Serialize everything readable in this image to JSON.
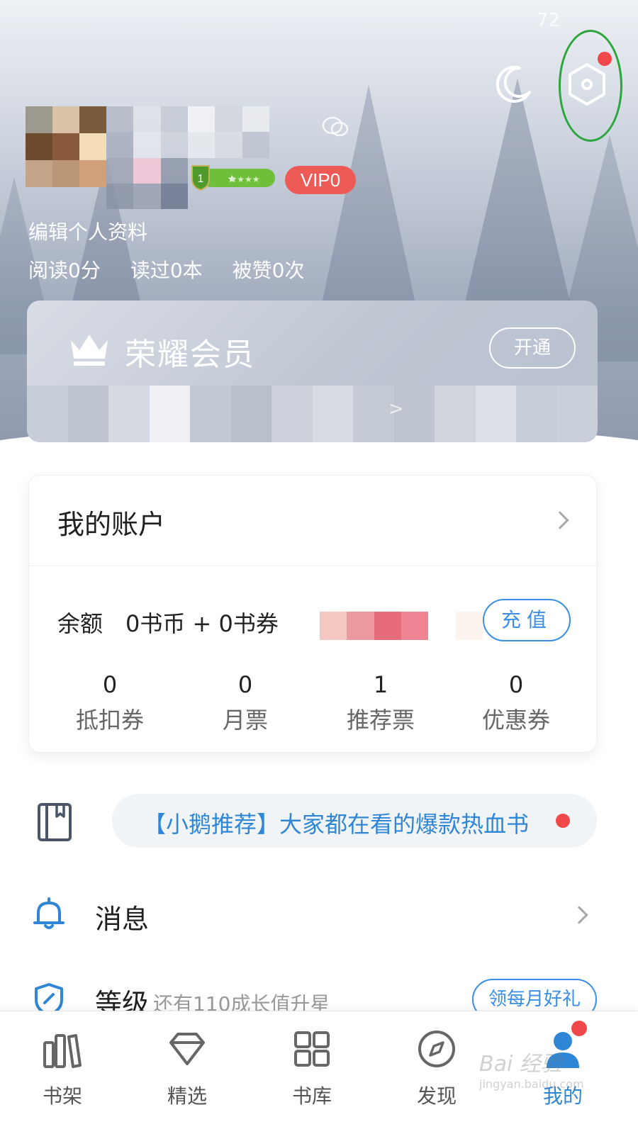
{
  "status_bar": {
    "time": "72"
  },
  "header": {
    "night_mode_icon": "moon-icon",
    "settings_icon": "hexagon-settings-icon",
    "settings_badge": true,
    "highlight_color": "#2aa63c",
    "wechat_icon": "wechat-icon",
    "level_badge_number": "1",
    "vip_label": "VIP0",
    "edit_profile_label": "编辑个人资料",
    "stats": [
      {
        "label": "阅读0分"
      },
      {
        "label": "读过0本"
      },
      {
        "label": "被赞0次"
      }
    ]
  },
  "vip_card": {
    "icon": "crown-icon",
    "title": "荣耀会员",
    "open_label": "开通",
    "chevron": ">"
  },
  "account": {
    "title": "我的账户",
    "balance_label": "余额",
    "balance_value": "0书币 + 0书券",
    "recharge_label": "充值",
    "stats": [
      {
        "value": "0",
        "label": "抵扣券"
      },
      {
        "value": "0",
        "label": "月票"
      },
      {
        "value": "1",
        "label": "推荐票"
      },
      {
        "value": "0",
        "label": "优惠券"
      }
    ]
  },
  "recommend": {
    "icon": "book-icon",
    "text": "【小鹅推荐】大家都在看的爆款热血书"
  },
  "menu": {
    "messages": {
      "icon": "bell-icon",
      "title": "消息"
    },
    "level": {
      "icon": "shield-icon",
      "title": "等级",
      "subtitle": "还有110成长值升星",
      "action_label": "领每月好礼"
    }
  },
  "tabbar": {
    "active_index": 4,
    "tabs": [
      {
        "label": "书架",
        "icon": "bookshelf-icon"
      },
      {
        "label": "精选",
        "icon": "diamond-icon"
      },
      {
        "label": "书库",
        "icon": "grid-icon"
      },
      {
        "label": "发现",
        "icon": "compass-icon"
      },
      {
        "label": "我的",
        "icon": "user-icon"
      }
    ]
  },
  "colors": {
    "accent": "#3a8ee6",
    "link": "#2f86d6",
    "badge_red": "#f04848",
    "vip_red": "#ee5a55"
  },
  "watermark": {
    "main": "Bai 经验",
    "sub": "jingyan.baidu.com"
  }
}
